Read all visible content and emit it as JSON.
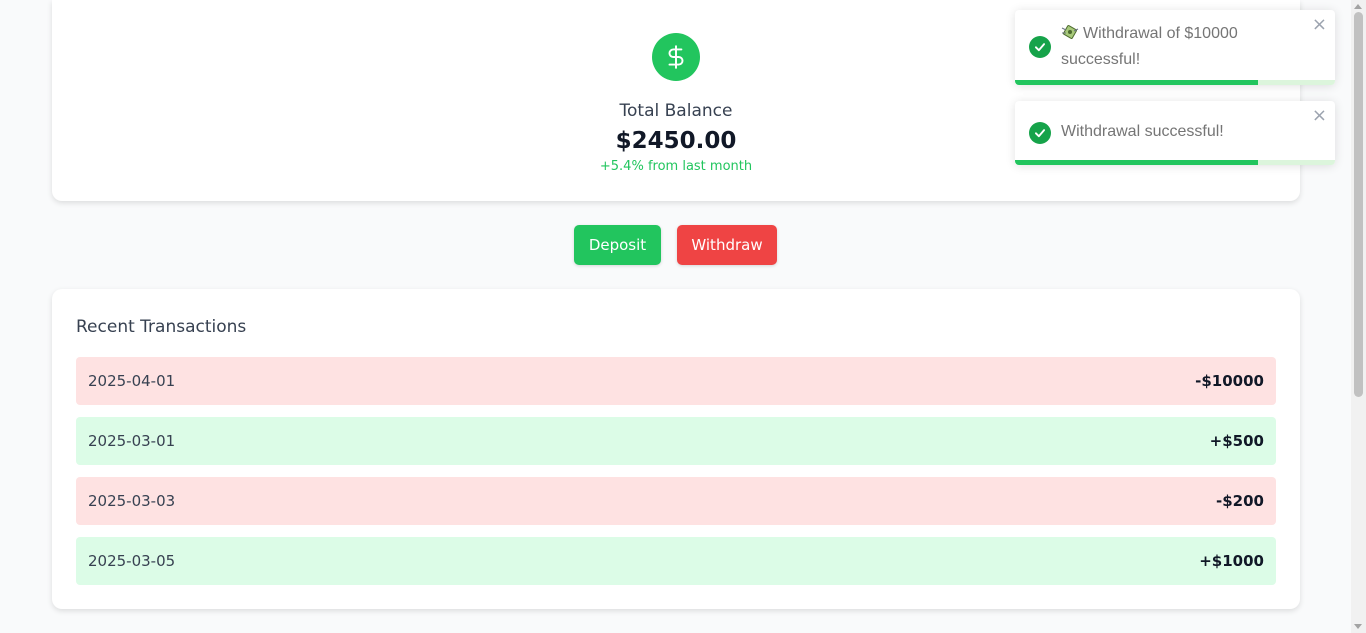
{
  "balance": {
    "label": "Total Balance",
    "amount": "$2450.00",
    "change": "+5.4% from last month",
    "icon": "dollar-icon",
    "accent": "#22c55e"
  },
  "actions": {
    "deposit_label": "Deposit",
    "withdraw_label": "Withdraw",
    "deposit_color": "#22c55e",
    "withdraw_color": "#ef4444"
  },
  "transactions": {
    "title": "Recent Transactions",
    "items": [
      {
        "date": "2025-04-01",
        "amount": "-$10000",
        "type": "debit"
      },
      {
        "date": "2025-03-01",
        "amount": "+$500",
        "type": "credit"
      },
      {
        "date": "2025-03-03",
        "amount": "-$200",
        "type": "debit"
      },
      {
        "date": "2025-03-05",
        "amount": "+$1000",
        "type": "credit"
      }
    ]
  },
  "toasts": [
    {
      "icon": "check-circle-icon",
      "prefix_icon": "money-with-wings-icon",
      "message": "Withdrawal of $10000 successful!",
      "close": "×",
      "progress": 0.76
    },
    {
      "icon": "check-circle-icon",
      "message": "Withdrawal successful!",
      "close": "×",
      "progress": 0.76
    }
  ]
}
